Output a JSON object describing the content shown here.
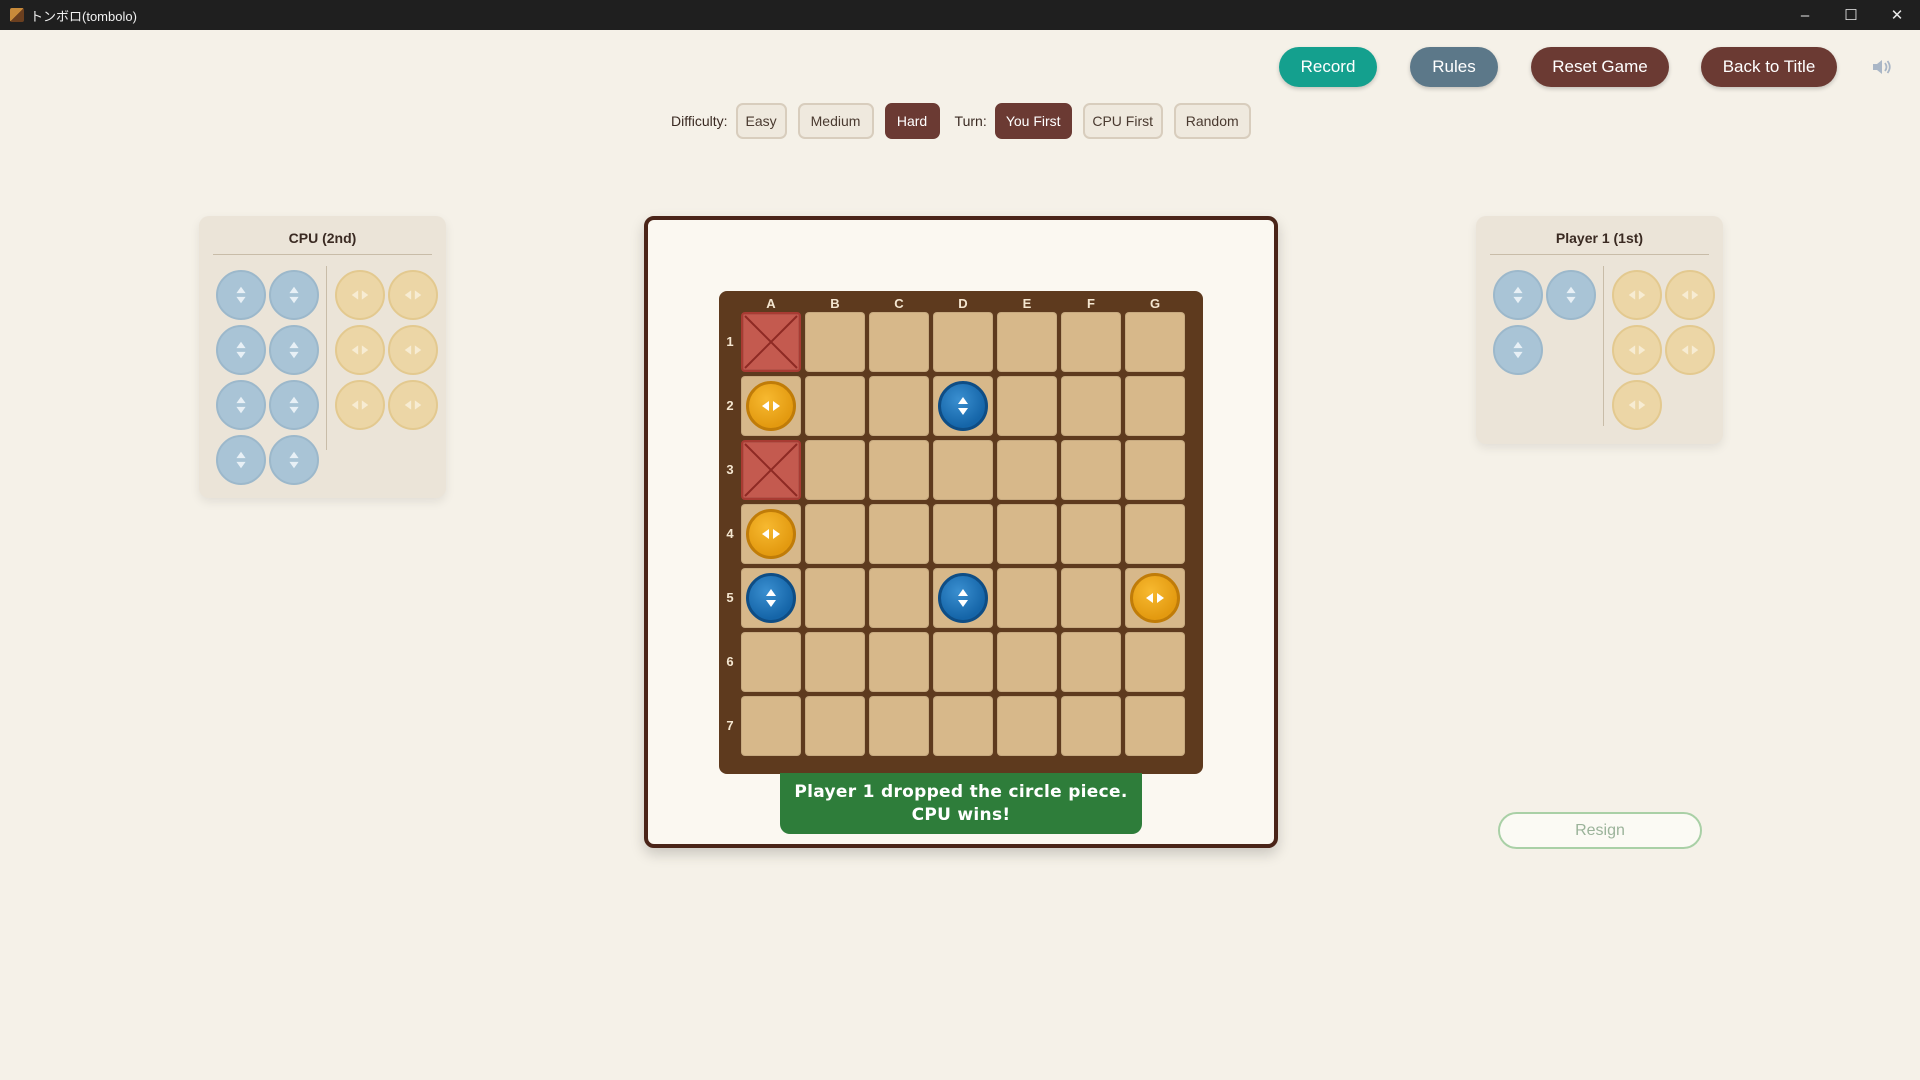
{
  "window": {
    "title": "トンボロ(tombolo)",
    "minimize": "–",
    "maximize": "☐",
    "close": "✕"
  },
  "top_buttons": {
    "record": "Record",
    "rules": "Rules",
    "reset": "Reset Game",
    "back": "Back to Title"
  },
  "settings": {
    "difficulty_label": "Difficulty:",
    "difficulty_options": [
      "Easy",
      "Medium",
      "Hard"
    ],
    "difficulty_selected": "Hard",
    "turn_label": "Turn:",
    "turn_options": [
      "You First",
      "CPU First",
      "Random"
    ],
    "turn_selected": "You First"
  },
  "cpu_panel": {
    "title": "CPU (2nd)",
    "blue_remaining": 8,
    "orange_remaining": 6
  },
  "player_panel": {
    "title": "Player 1 (1st)",
    "blue_remaining": 3,
    "orange_remaining": 5
  },
  "board": {
    "columns": [
      "A",
      "B",
      "C",
      "D",
      "E",
      "F",
      "G"
    ],
    "rows": [
      "1",
      "2",
      "3",
      "4",
      "5",
      "6",
      "7"
    ],
    "blocked": [
      "A1",
      "A3"
    ],
    "pieces": [
      {
        "cell": "A2",
        "type": "orange"
      },
      {
        "cell": "D2",
        "type": "blue"
      },
      {
        "cell": "A4",
        "type": "orange"
      },
      {
        "cell": "A5",
        "type": "blue"
      },
      {
        "cell": "D5",
        "type": "blue"
      },
      {
        "cell": "G5",
        "type": "orange"
      }
    ]
  },
  "status": {
    "line1": "Player 1 dropped the circle piece.",
    "line2": "CPU wins!"
  },
  "resign": "Resign",
  "colors": {
    "accent_teal": "#14a08e",
    "brand_brown": "#6b3a33",
    "win_green": "#2e7d3a",
    "piece_blue": "#1565a8",
    "piece_orange": "#e39a10"
  }
}
